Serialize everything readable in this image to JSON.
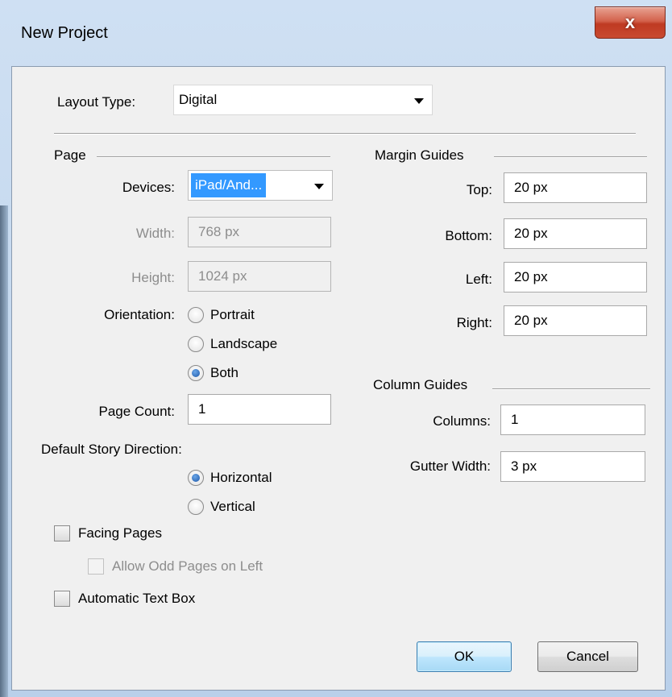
{
  "window": {
    "title": "New Project",
    "close_label": "x"
  },
  "layout_type": {
    "label": "Layout Type:",
    "value": "Digital"
  },
  "page": {
    "legend": "Page",
    "devices_label": "Devices:",
    "devices_value": "iPad/And...",
    "width_label": "Width:",
    "width_value": "768 px",
    "height_label": "Height:",
    "height_value": "1024 px",
    "orientation_label": "Orientation:",
    "orientation_options": [
      "Portrait",
      "Landscape",
      "Both"
    ],
    "orientation_selected": "Both",
    "page_count_label": "Page Count:",
    "page_count_value": "1"
  },
  "story": {
    "label": "Default Story Direction:",
    "options": [
      "Horizontal",
      "Vertical"
    ],
    "selected": "Horizontal"
  },
  "checkboxes": {
    "facing_pages": "Facing Pages",
    "allow_odd": "Allow Odd Pages on Left",
    "auto_text_box": "Automatic Text Box"
  },
  "margin_guides": {
    "legend": "Margin Guides",
    "top_label": "Top:",
    "top_value": "20 px",
    "bottom_label": "Bottom:",
    "bottom_value": "20 px",
    "left_label": "Left:",
    "left_value": "20 px",
    "right_label": "Right:",
    "right_value": "20 px"
  },
  "column_guides": {
    "legend": "Column Guides",
    "columns_label": "Columns:",
    "columns_value": "1",
    "gutter_label": "Gutter Width:",
    "gutter_value": "3 px"
  },
  "buttons": {
    "ok": "OK",
    "cancel": "Cancel"
  }
}
